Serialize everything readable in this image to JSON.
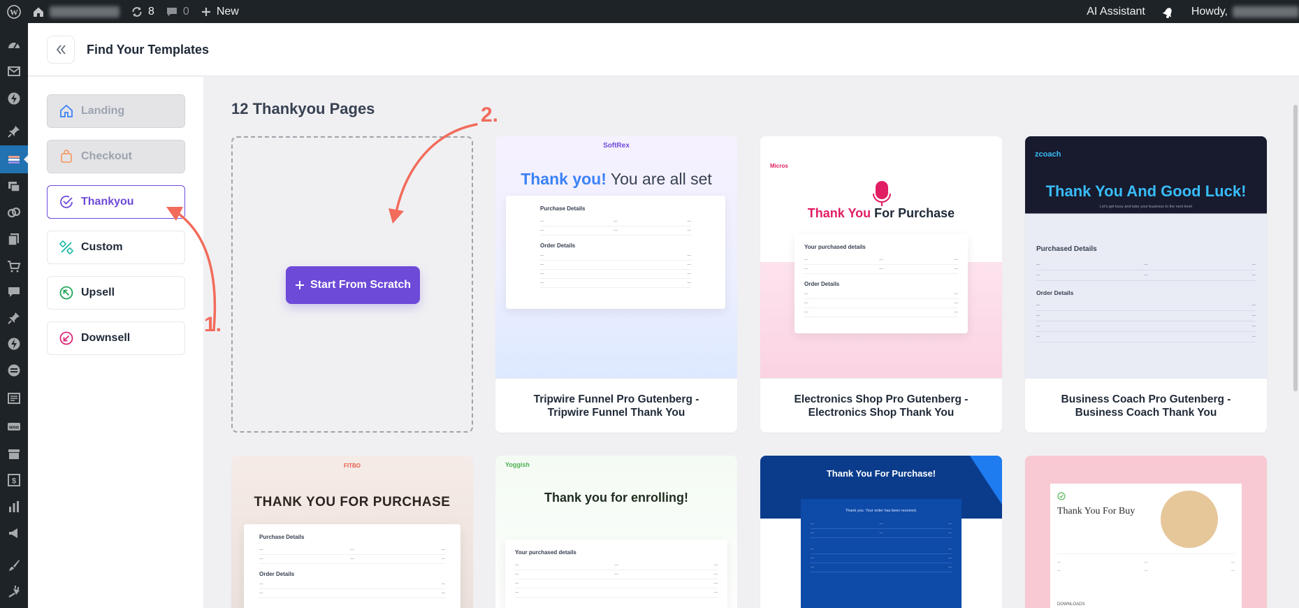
{
  "adminbar": {
    "updates_count": "8",
    "comments_count": "0",
    "new_label": "New",
    "ai_assistant": "AI Assistant",
    "howdy": "Howdy,"
  },
  "header": {
    "title": "Find Your Templates"
  },
  "sidebar_tabs": [
    {
      "label": "Landing",
      "icon": "home-icon",
      "state": "disabled"
    },
    {
      "label": "Checkout",
      "icon": "shopping-bag-icon",
      "state": "disabled"
    },
    {
      "label": "Thankyou",
      "icon": "check-circle-icon",
      "state": "active"
    },
    {
      "label": "Custom",
      "icon": "tools-icon",
      "state": "normal"
    },
    {
      "label": "Upsell",
      "icon": "arrow-up-left-circle-icon",
      "state": "normal"
    },
    {
      "label": "Downsell",
      "icon": "arrow-down-left-circle-icon",
      "state": "normal"
    }
  ],
  "main": {
    "section_title": "12 Thankyou Pages",
    "start_scratch_label": "Start From Scratch",
    "templates": [
      {
        "caption": "Tripwire Funnel Pro Gutenberg - Tripwire Funnel Thank You",
        "brand": "SoftRex",
        "headline_a": "Thank you!",
        "headline_b": " You are all set",
        "doc_title": "Purchase Details",
        "order_details": "Order Details"
      },
      {
        "caption": "Electronics Shop Pro Gutenberg - Electronics Shop Thank You",
        "brand": "Micros",
        "headline_a": "Thank You",
        "headline_b": " For Purchase",
        "doc_title": "Your purchased details",
        "order_details": "Order Details"
      },
      {
        "caption": "Business Coach Pro Gutenberg - Business Coach Thank You",
        "brand": "zcoach",
        "headline_a": "Thank You And Good Luck!",
        "subline": "Let's get busy and take your business to the next level",
        "doc_title": "Purchased Details",
        "order_details": "Order Details"
      },
      {
        "brand": "FITBO",
        "headline_a": "THANK YOU FOR PURCHASE",
        "doc_title": "Purchase Details",
        "order_details": "Order Details"
      },
      {
        "brand": "Yoggish",
        "headline_a": "Thank you for enrolling!",
        "doc_title": "Your purchased details"
      },
      {
        "headline_a": "Thank You For Purchase!",
        "doc_title": "Thank you. Your order has been received."
      },
      {
        "headline_a": "Thank You For Buy",
        "doc_title": "DOWNLOADS"
      }
    ]
  },
  "annotations": {
    "step1": "1.",
    "step2": "2."
  },
  "colors": {
    "accent": "#6d4ad8",
    "annotation": "#f26b5b",
    "wp_dark": "#1d2327",
    "wp_blue": "#2271b1"
  }
}
